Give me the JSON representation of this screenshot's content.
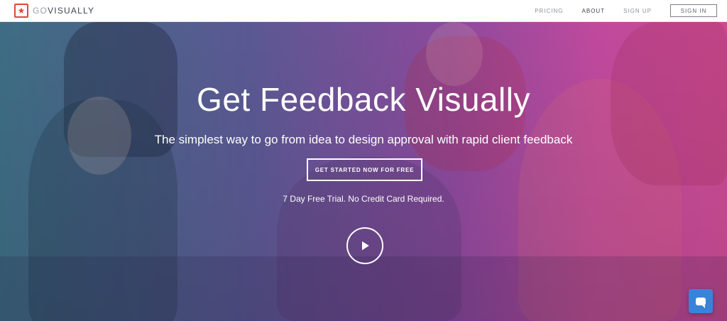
{
  "nav": {
    "logo_text_prefix": "GO",
    "logo_text_suffix": "VISUALLY",
    "logo_icon": "star-badge-icon",
    "links": [
      {
        "label": "PRICING"
      },
      {
        "label": "ABOUT"
      },
      {
        "label": "SIGN UP"
      }
    ],
    "signin_label": "SIGN IN"
  },
  "hero": {
    "title": "Get Feedback Visually",
    "subtitle": "The simplest way to go from idea to design approval with rapid client feedback",
    "cta_label": "GET STARTED NOW FOR FREE",
    "trial_note": "7 Day Free Trial. No Credit Card Required.",
    "play_icon": "play-icon"
  },
  "chat": {
    "icon": "chat-bubble-icon",
    "color": "#3b82d9"
  },
  "colors": {
    "brand": "#e0463c",
    "gradient_start": "#3f6f86",
    "gradient_end": "#cf4d97"
  }
}
